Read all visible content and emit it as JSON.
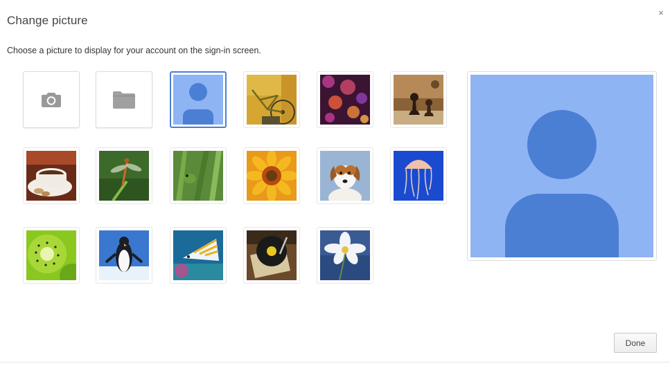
{
  "dialog": {
    "title": "Change picture",
    "description": "Choose a picture to display for your account on the sign-in screen.",
    "close_label": "×",
    "done_label": "Done"
  },
  "colors": {
    "accent": "#4a7fd4",
    "avatar_bg": "#8fb4f4",
    "avatar_fg": "#4a7fd4"
  },
  "tiles": [
    {
      "kind": "action",
      "icon": "camera-icon",
      "selected": false
    },
    {
      "kind": "action",
      "icon": "folder-icon",
      "selected": false
    },
    {
      "kind": "avatar",
      "icon": "default-profile-icon",
      "selected": true
    },
    {
      "kind": "image",
      "subject": "bicycle",
      "selected": false
    },
    {
      "kind": "image",
      "subject": "bokeh-lights",
      "selected": false
    },
    {
      "kind": "image",
      "subject": "chess-pieces",
      "selected": false
    },
    {
      "kind": "image",
      "subject": "coffee-cup",
      "selected": false
    },
    {
      "kind": "image",
      "subject": "dragonfly",
      "selected": false
    },
    {
      "kind": "image",
      "subject": "frog-on-grass",
      "selected": false
    },
    {
      "kind": "image",
      "subject": "orange-flower",
      "selected": false
    },
    {
      "kind": "image",
      "subject": "puppy",
      "selected": false
    },
    {
      "kind": "image",
      "subject": "jellyfish",
      "selected": false
    },
    {
      "kind": "image",
      "subject": "kiwi-slice",
      "selected": false
    },
    {
      "kind": "image",
      "subject": "penguin",
      "selected": false
    },
    {
      "kind": "image",
      "subject": "tropical-fish",
      "selected": false
    },
    {
      "kind": "image",
      "subject": "record-player",
      "selected": false
    },
    {
      "kind": "image",
      "subject": "white-flower",
      "selected": false
    }
  ],
  "preview": {
    "icon": "default-profile-icon"
  }
}
